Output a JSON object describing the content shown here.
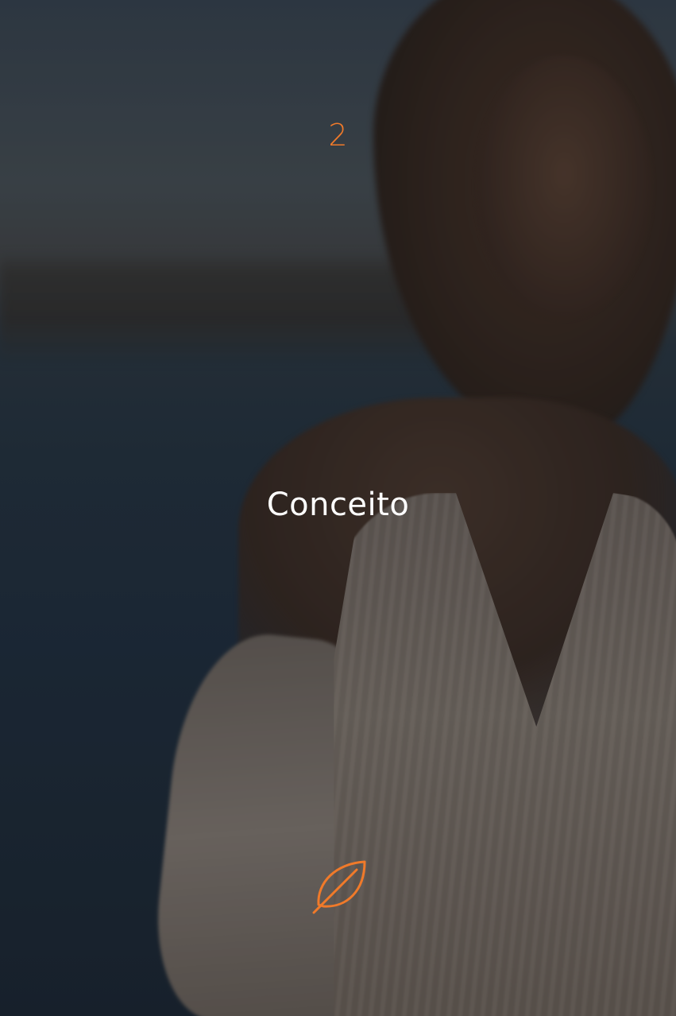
{
  "slide": {
    "page_number": "2",
    "title": "Conceito",
    "icon": "leaf-icon",
    "accent_color": "#f07a2a",
    "title_color": "#ffffff"
  }
}
